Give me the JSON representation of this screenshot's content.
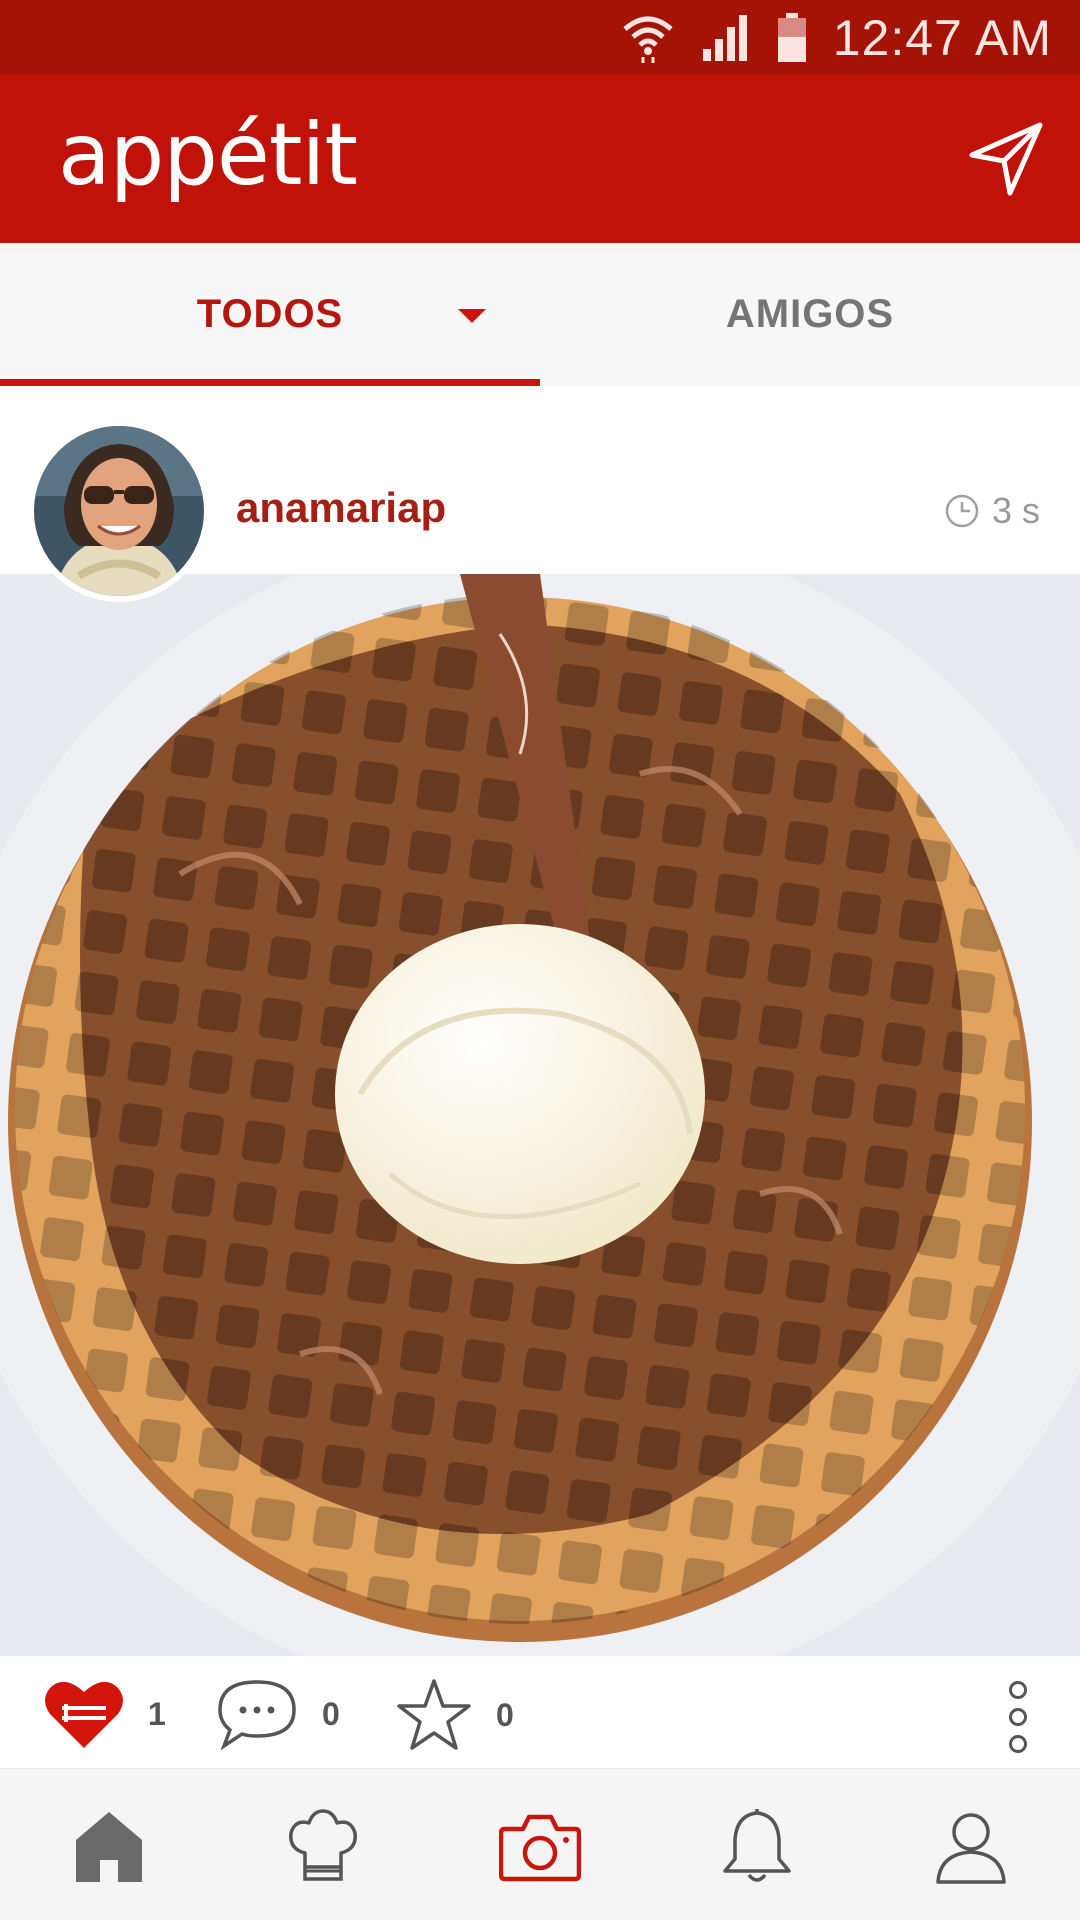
{
  "status_bar": {
    "time": "12:47 AM",
    "icons": [
      "wifi-icon",
      "signal-icon",
      "battery-icon"
    ]
  },
  "app_bar": {
    "title": "appétit",
    "send_icon": "send-icon"
  },
  "tabs": [
    {
      "label": "TODOS",
      "selected": true,
      "has_dropdown": true
    },
    {
      "label": "AMIGOS",
      "selected": false
    }
  ],
  "post": {
    "username": "anamariap",
    "time_ago": "3 s",
    "actions": {
      "likes": "1",
      "comments": "0",
      "favorites": "0"
    }
  },
  "bottom_nav": [
    {
      "icon": "home-icon",
      "active": true
    },
    {
      "icon": "chef-hat-icon",
      "active": false
    },
    {
      "icon": "camera-icon",
      "active": false,
      "accent": true
    },
    {
      "icon": "bell-icon",
      "active": false
    },
    {
      "icon": "profile-icon",
      "active": false
    }
  ],
  "colors": {
    "status_bar": "#a51206",
    "app_bar": "#c01208",
    "accent": "#c8160c",
    "tab_inactive": "#757575"
  }
}
